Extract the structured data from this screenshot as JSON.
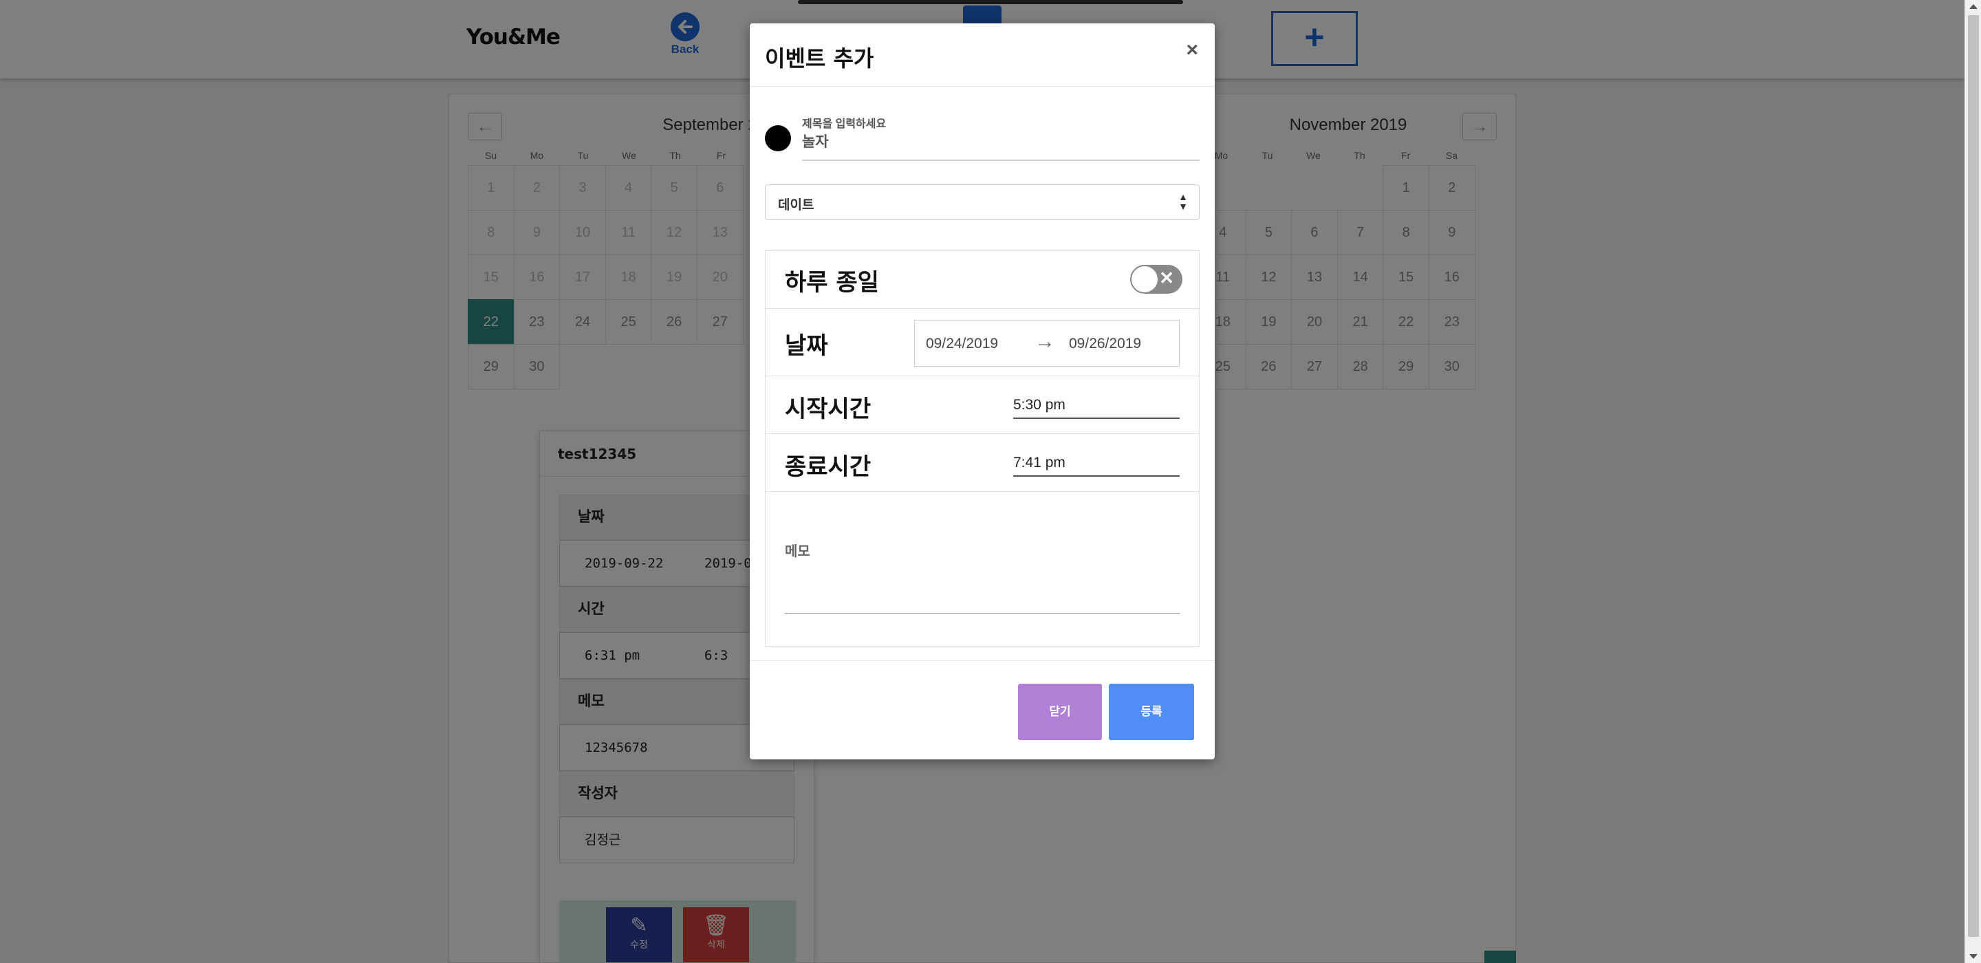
{
  "app": {
    "brand": "You&Me",
    "back_label": "Back",
    "add_label": "+"
  },
  "calendar": {
    "prev_arrow": "←",
    "next_arrow": "→",
    "days_of_week": [
      "Su",
      "Mo",
      "Tu",
      "We",
      "Th",
      "Fr",
      "Sa"
    ],
    "september": {
      "title": "September 2019",
      "weeks": [
        [
          "1",
          "2",
          "3",
          "4",
          "5",
          "6"
        ],
        [
          "8",
          "9",
          "10",
          "11",
          "12",
          "13"
        ],
        [
          "15",
          "16",
          "17",
          "18",
          "19",
          "20"
        ],
        [
          "22",
          "23",
          "24",
          "25",
          "26",
          "27"
        ],
        [
          "29",
          "30"
        ]
      ],
      "selected_day": "22"
    },
    "november": {
      "title": "November 2019",
      "weeks": [
        [
          "",
          "",
          "",
          "",
          "1",
          "2"
        ],
        [
          "4",
          "5",
          "6",
          "7",
          "8",
          "9"
        ],
        [
          "11",
          "12",
          "13",
          "14",
          "15",
          "16"
        ],
        [
          "18",
          "19",
          "20",
          "21",
          "22",
          "23"
        ],
        [
          "25",
          "26",
          "27",
          "28",
          "29",
          "30"
        ]
      ]
    }
  },
  "event_card": {
    "title": "test12345",
    "date_label": "날짜",
    "date_start": "2019-09-22",
    "date_end": "2019-0",
    "time_label": "시간",
    "time_start": "6:31 pm",
    "time_end": "6:3",
    "memo_label": "메모",
    "memo_value": "12345678",
    "author_label": "작성자",
    "author_value": "김정근",
    "edit_label": "수정",
    "delete_label": "삭제"
  },
  "modal": {
    "title": "이벤트 추가",
    "close_symbol": "×",
    "title_field_label": "제목을 입력하세요",
    "title_field_value": "놀자",
    "category_value": "데이트",
    "category_arrow": "⬍",
    "allday_label": "하루 종일",
    "allday_on": false,
    "date_label": "날짜",
    "date_start": "09/24/2019",
    "date_arrow": "→",
    "date_end": "09/26/2019",
    "start_time_label": "시작시간",
    "start_time_value": "5:30 pm",
    "end_time_label": "종료시간",
    "end_time_value": "7:41 pm",
    "memo_label": "메모",
    "close_button": "닫기",
    "submit_button": "등록"
  },
  "colors": {
    "selected_day": "#2e8b80",
    "brand_blue": "#1f66d6",
    "close_button": "#b07fd6",
    "submit_button": "#4f8ff5",
    "edit_button": "#2c3e9c",
    "delete_button": "#d9413a"
  }
}
